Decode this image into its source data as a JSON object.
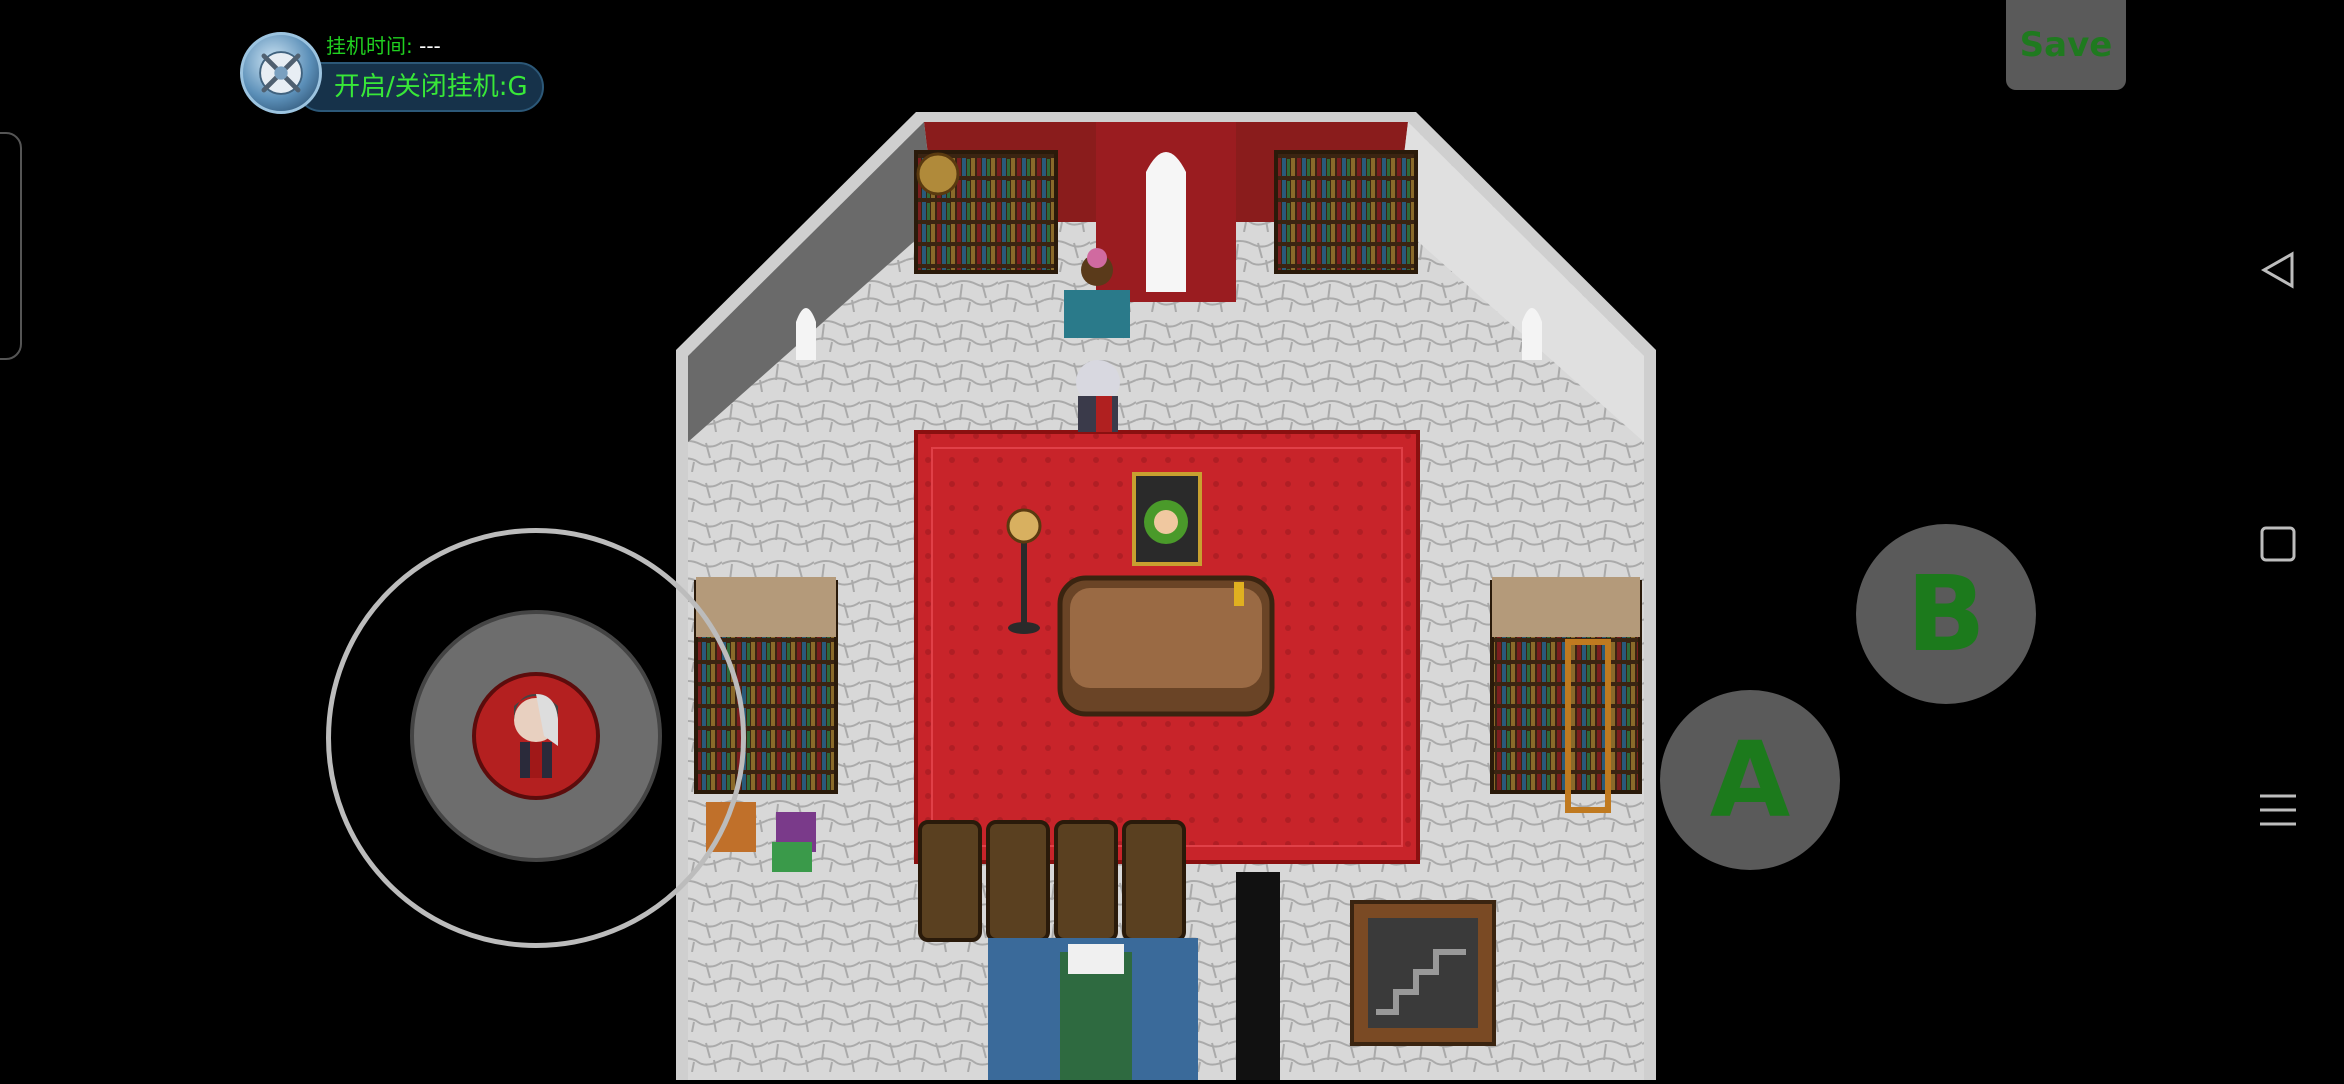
{
  "hud": {
    "time_label": "挂机时间:",
    "time_value": "---",
    "toggle_label": "开启/关闭挂机:G",
    "save_label": "Save"
  },
  "controls": {
    "a_label": "A",
    "b_label": "B"
  },
  "icons": {
    "hud": "gear-swords-icon",
    "nav_back": "triangle-back-icon",
    "nav_home": "square-home-icon",
    "nav_menu": "hamburger-menu-icon"
  },
  "colors": {
    "hud_green": "#38e838",
    "button_grey": "#5a5a5a",
    "button_letter_green": "#1c7a1c",
    "carpet_red": "#c8242a",
    "joystick_knob": "#b42020"
  }
}
